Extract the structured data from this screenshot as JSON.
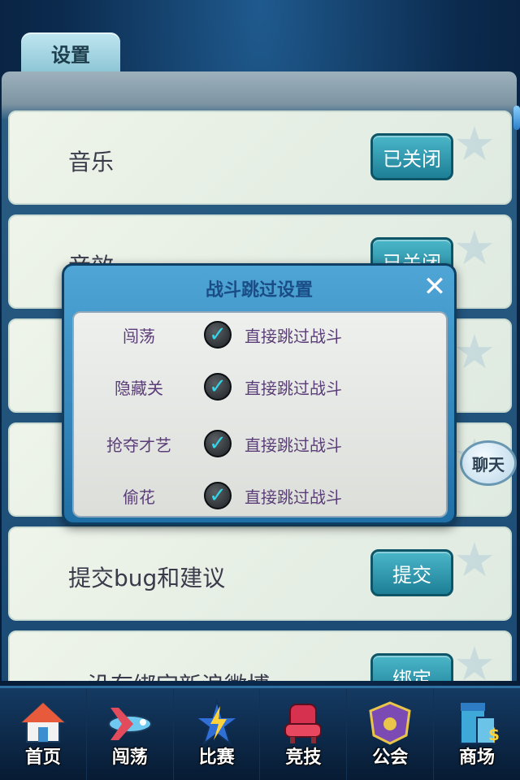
{
  "header": {
    "tab_label": "设置"
  },
  "settings": {
    "rows": [
      {
        "label": "音乐",
        "button": "已关闭"
      },
      {
        "label": "音效",
        "button": "已关闭"
      },
      {
        "label": "",
        "button": ""
      },
      {
        "label": "",
        "button": ""
      },
      {
        "label": "提交bug和建议",
        "button": "提交"
      },
      {
        "label": "没有绑定新浪微博",
        "button": "绑定"
      }
    ]
  },
  "chat_button": "聊天",
  "modal": {
    "title": "战斗跳过设置",
    "close_icon": "close-icon",
    "items": [
      {
        "name": "闯荡",
        "desc": "直接跳过战斗",
        "checked": true
      },
      {
        "name": "隐藏关",
        "desc": "直接跳过战斗",
        "checked": true
      },
      {
        "name": "抢夺才艺",
        "desc": "直接跳过战斗",
        "checked": true
      },
      {
        "name": "偷花",
        "desc": "直接跳过战斗",
        "checked": true
      }
    ]
  },
  "nav": {
    "items": [
      {
        "label": "首页",
        "icon": "house-icon"
      },
      {
        "label": "闯荡",
        "icon": "airplane-icon"
      },
      {
        "label": "比赛",
        "icon": "lightning-icon"
      },
      {
        "label": "竞技",
        "icon": "throne-icon"
      },
      {
        "label": "公会",
        "icon": "crest-icon"
      },
      {
        "label": "商场",
        "icon": "shop-icon"
      }
    ]
  },
  "colors": {
    "accent": "#1d7f96",
    "modal_text": "#5b3d78",
    "check": "#33d6e8"
  }
}
